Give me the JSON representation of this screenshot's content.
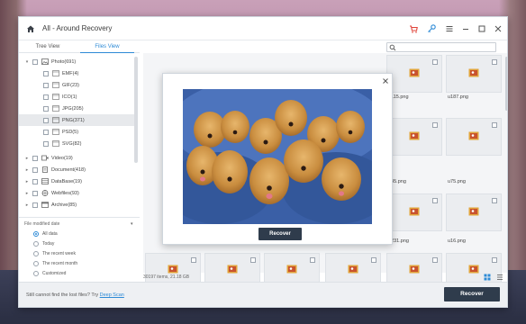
{
  "window": {
    "title": "All - Around Recovery"
  },
  "tabs": [
    {
      "label": "Tree View",
      "active": false
    },
    {
      "label": "Files View",
      "active": true
    }
  ],
  "tree": {
    "items": [
      {
        "label": "Photo(691)",
        "level": 0,
        "expanded": true,
        "icon": "photo-icon"
      },
      {
        "label": "EMF(4)",
        "level": 1,
        "icon": "image-file-icon"
      },
      {
        "label": "GIF(23)",
        "level": 1,
        "icon": "image-file-icon"
      },
      {
        "label": "ICO(1)",
        "level": 1,
        "icon": "image-file-icon"
      },
      {
        "label": "JPG(205)",
        "level": 1,
        "icon": "image-file-icon"
      },
      {
        "label": "PNG(371)",
        "level": 1,
        "icon": "image-file-icon",
        "selected": true
      },
      {
        "label": "PSD(5)",
        "level": 1,
        "icon": "image-file-icon"
      },
      {
        "label": "SVG(82)",
        "level": 1,
        "icon": "image-file-icon"
      },
      {
        "label": "Video(19)",
        "level": 0,
        "icon": "video-icon"
      },
      {
        "label": "Document(418)",
        "level": 0,
        "icon": "document-icon"
      },
      {
        "label": "DataBase(19)",
        "level": 0,
        "icon": "database-icon"
      },
      {
        "label": "Webfiles(93)",
        "level": 0,
        "icon": "globe-icon"
      },
      {
        "label": "Archive(85)",
        "level": 0,
        "icon": "archive-icon"
      }
    ]
  },
  "filter": {
    "title": "File modified date",
    "options": [
      {
        "label": "All data",
        "selected": true
      },
      {
        "label": "Today",
        "selected": false
      },
      {
        "label": "The recent week",
        "selected": false
      },
      {
        "label": "The recent month",
        "selected": false
      },
      {
        "label": "Customized",
        "selected": false
      }
    ]
  },
  "search": {
    "placeholder": ""
  },
  "grid": {
    "labels": [
      "u115.png",
      "u187.png",
      "u45.png",
      "u75.png",
      "u231.png",
      "u16.png"
    ]
  },
  "status": {
    "summary": "30197 items, 21.18 GB"
  },
  "bottom": {
    "message_prefix": "Still cannot find the lost files? Try",
    "deep_scan": "Deep Scan",
    "recover_label": "Recover"
  },
  "preview": {
    "recover_label": "Recover"
  },
  "colors": {
    "accent": "#2d8ad6",
    "button_dark": "#2f3c4c",
    "file_icon_red": "#c8532f",
    "file_icon_gold": "#e2a43a"
  }
}
